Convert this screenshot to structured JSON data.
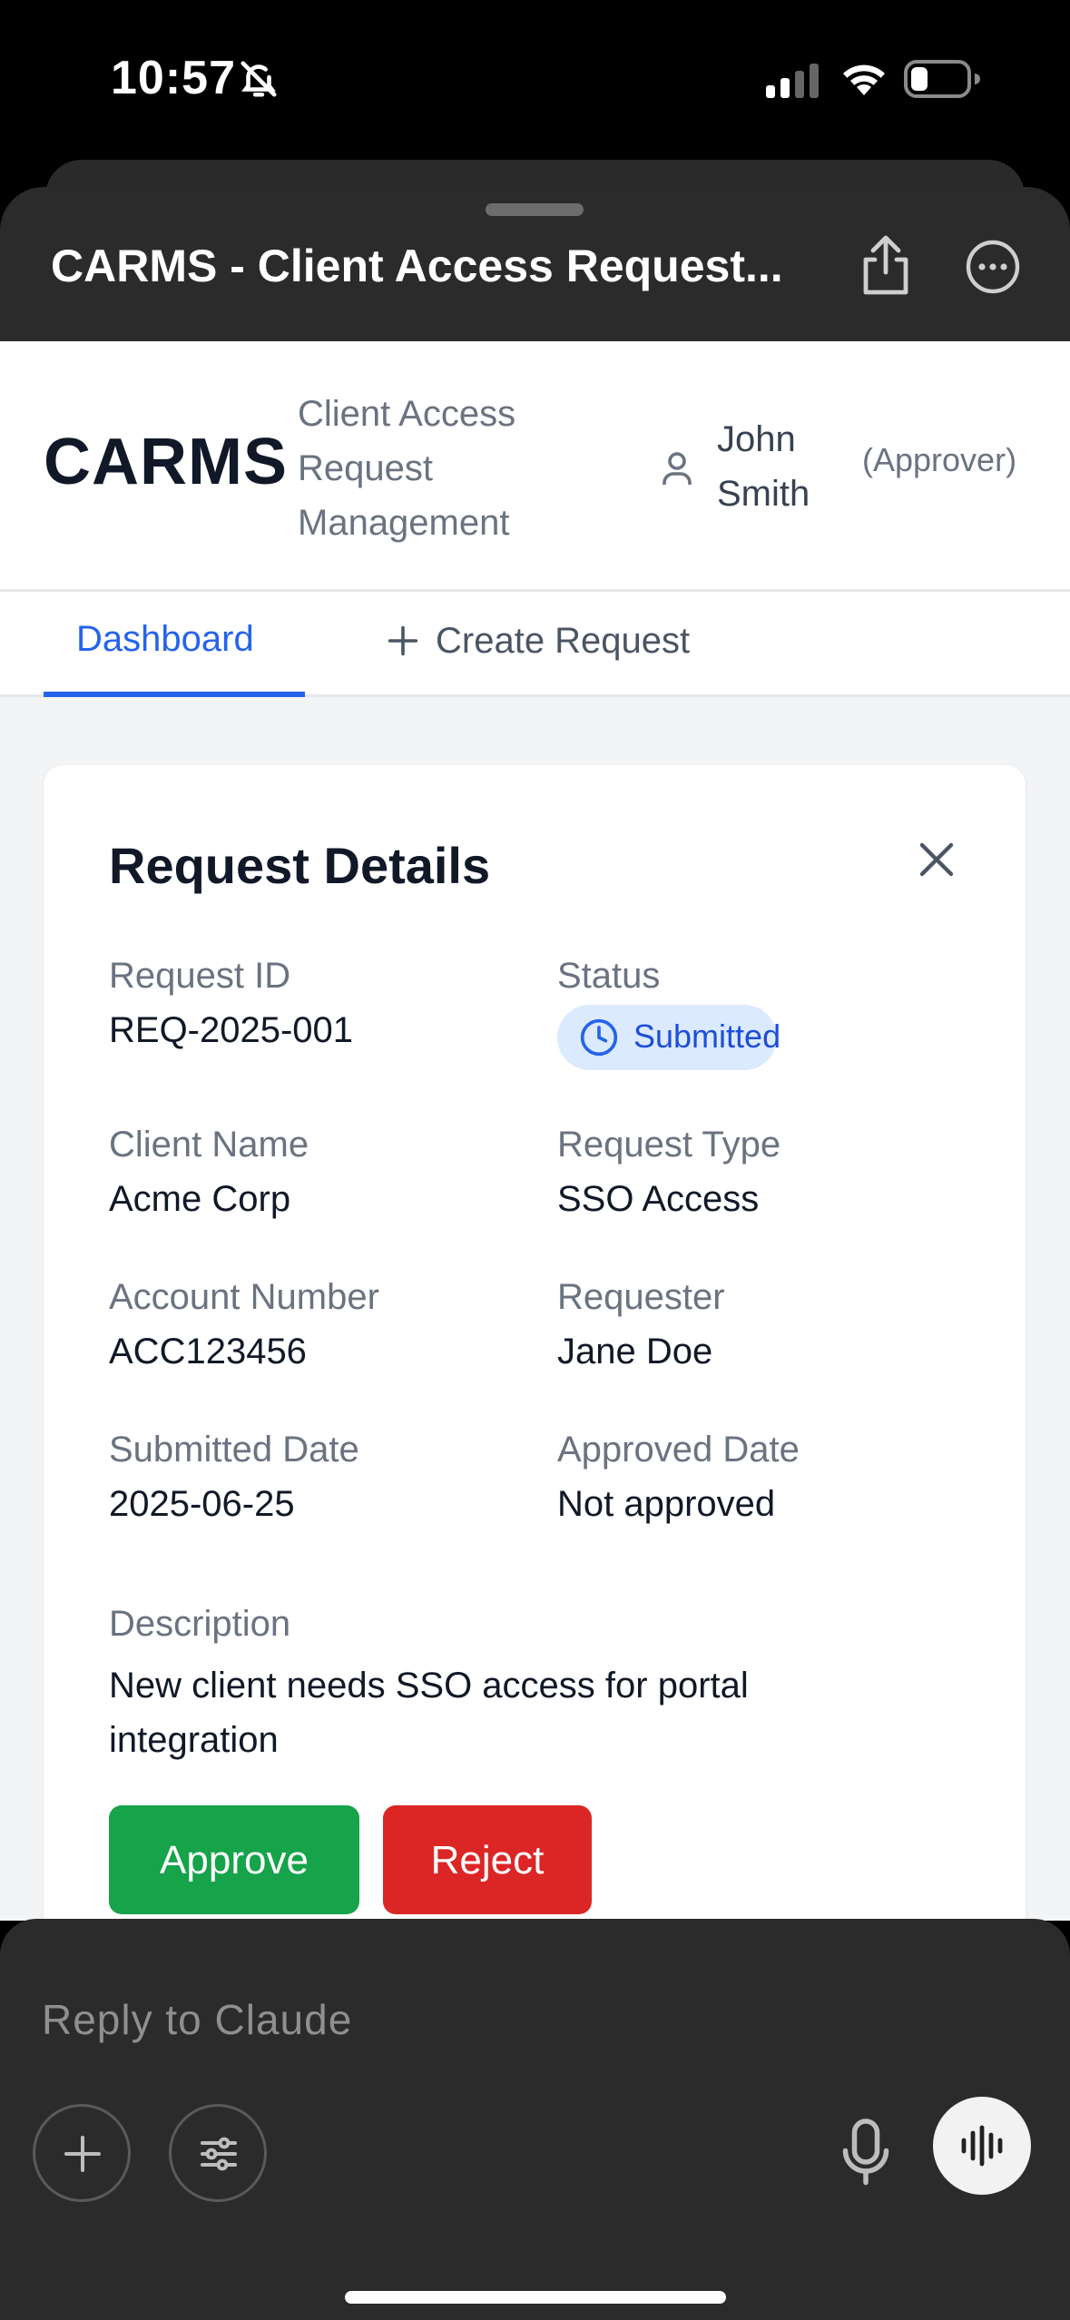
{
  "status_bar": {
    "time": "10:57"
  },
  "artifact_header": {
    "title": "CARMS - Client Access Request..."
  },
  "app_header": {
    "logo": "CARMS",
    "subtitle_line1": "Client Access",
    "subtitle_line2": "Request",
    "subtitle_line3": "Management",
    "user_first": "John",
    "user_last": "Smith",
    "user_role": "(Approver)"
  },
  "tabs": [
    {
      "label": "Dashboard",
      "active": true
    },
    {
      "label": "Create Request",
      "active": false
    }
  ],
  "request_details": {
    "title": "Request Details",
    "fields": {
      "request_id": {
        "label": "Request ID",
        "value": "REQ-2025-001"
      },
      "status": {
        "label": "Status",
        "value": "Submitted"
      },
      "client_name": {
        "label": "Client Name",
        "value": "Acme Corp"
      },
      "request_type": {
        "label": "Request Type",
        "value": "SSO Access"
      },
      "account_number": {
        "label": "Account Number",
        "value": "ACC123456"
      },
      "requester": {
        "label": "Requester",
        "value": "Jane Doe"
      },
      "submitted_date": {
        "label": "Submitted Date",
        "value": "2025-06-25"
      },
      "approved_date": {
        "label": "Approved Date",
        "value": "Not approved"
      },
      "description": {
        "label": "Description",
        "value": "New client needs SSO access for portal integration"
      }
    },
    "actions": {
      "approve": "Approve",
      "reject": "Reject"
    }
  },
  "reply": {
    "placeholder": "Reply to Claude"
  },
  "colors": {
    "primary": "#2563eb",
    "approve": "#16a34a",
    "reject": "#dc2626",
    "badge_bg": "#dbeafe"
  }
}
